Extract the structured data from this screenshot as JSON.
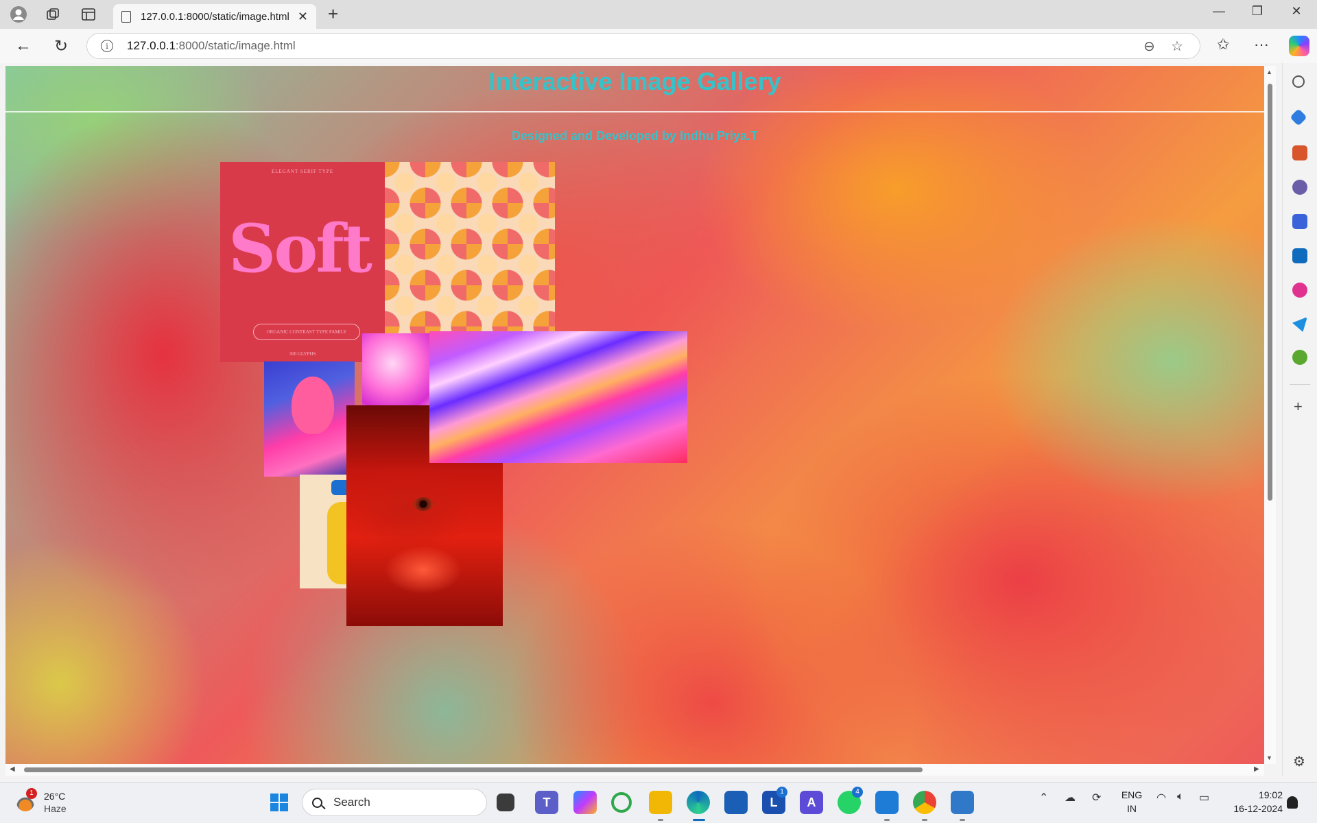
{
  "browser": {
    "tab_title": "127.0.0.1:8000/static/image.html",
    "url_host": "127.0.0.1",
    "url_rest": ":8000/static/image.html"
  },
  "page": {
    "title": "Interactive Image Gallery",
    "subtitle": "Designed and Developed by Indhu Priya.T",
    "soft_poster": {
      "caption_top": "ELEGANT SERIF TYPE",
      "headline": "Soft",
      "pill": "ORGANIC CONTRAST TYPE FAMILY",
      "caption_bottom": "300 GLYPHS"
    }
  },
  "taskbar": {
    "weather_temp": "26°C",
    "weather_text": "Haze",
    "weather_badge": "1",
    "search_label": "Search",
    "lens_badge": "1",
    "whatsapp_badge": "4",
    "lang_line1": "ENG",
    "lang_line2": "IN",
    "time": "19:02",
    "date": "16-12-2024"
  },
  "colors": {
    "title_text": "#36c2c9",
    "accent_edge": "#0f6cbd"
  }
}
